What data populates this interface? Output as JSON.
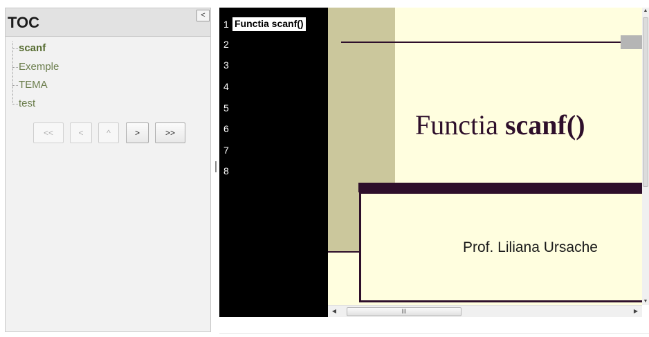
{
  "toc": {
    "title": "TOC",
    "collapse_glyph": "<",
    "items": [
      {
        "label": "scanf",
        "active": true
      },
      {
        "label": "Exemple",
        "active": false
      },
      {
        "label": "TEMA",
        "active": false
      },
      {
        "label": "test",
        "active": false
      }
    ],
    "nav_buttons": [
      {
        "label": "<<",
        "enabled": false
      },
      {
        "label": "<",
        "enabled": false
      },
      {
        "label": "^",
        "enabled": false
      },
      {
        "label": ">",
        "enabled": true
      },
      {
        "label": ">>",
        "enabled": true
      }
    ]
  },
  "slides": {
    "numbers": [
      "1",
      "2",
      "3",
      "4",
      "5",
      "6",
      "7",
      "8"
    ],
    "current_title": "Functia scanf()"
  },
  "slide": {
    "heading_normal": "Functia ",
    "heading_bold": "scanf()",
    "author": "Prof. Liliana Ursache"
  },
  "scrollbars": {
    "up_arrow": "▲",
    "down_arrow": "▼",
    "left_arrow": "◀",
    "right_arrow": "▶",
    "grip": "III"
  },
  "colors": {
    "accent_dark": "#2e0f2b",
    "slide_background": "#fffedf",
    "olive": "#cbc79c",
    "toc_link": "#6b7d4c"
  }
}
